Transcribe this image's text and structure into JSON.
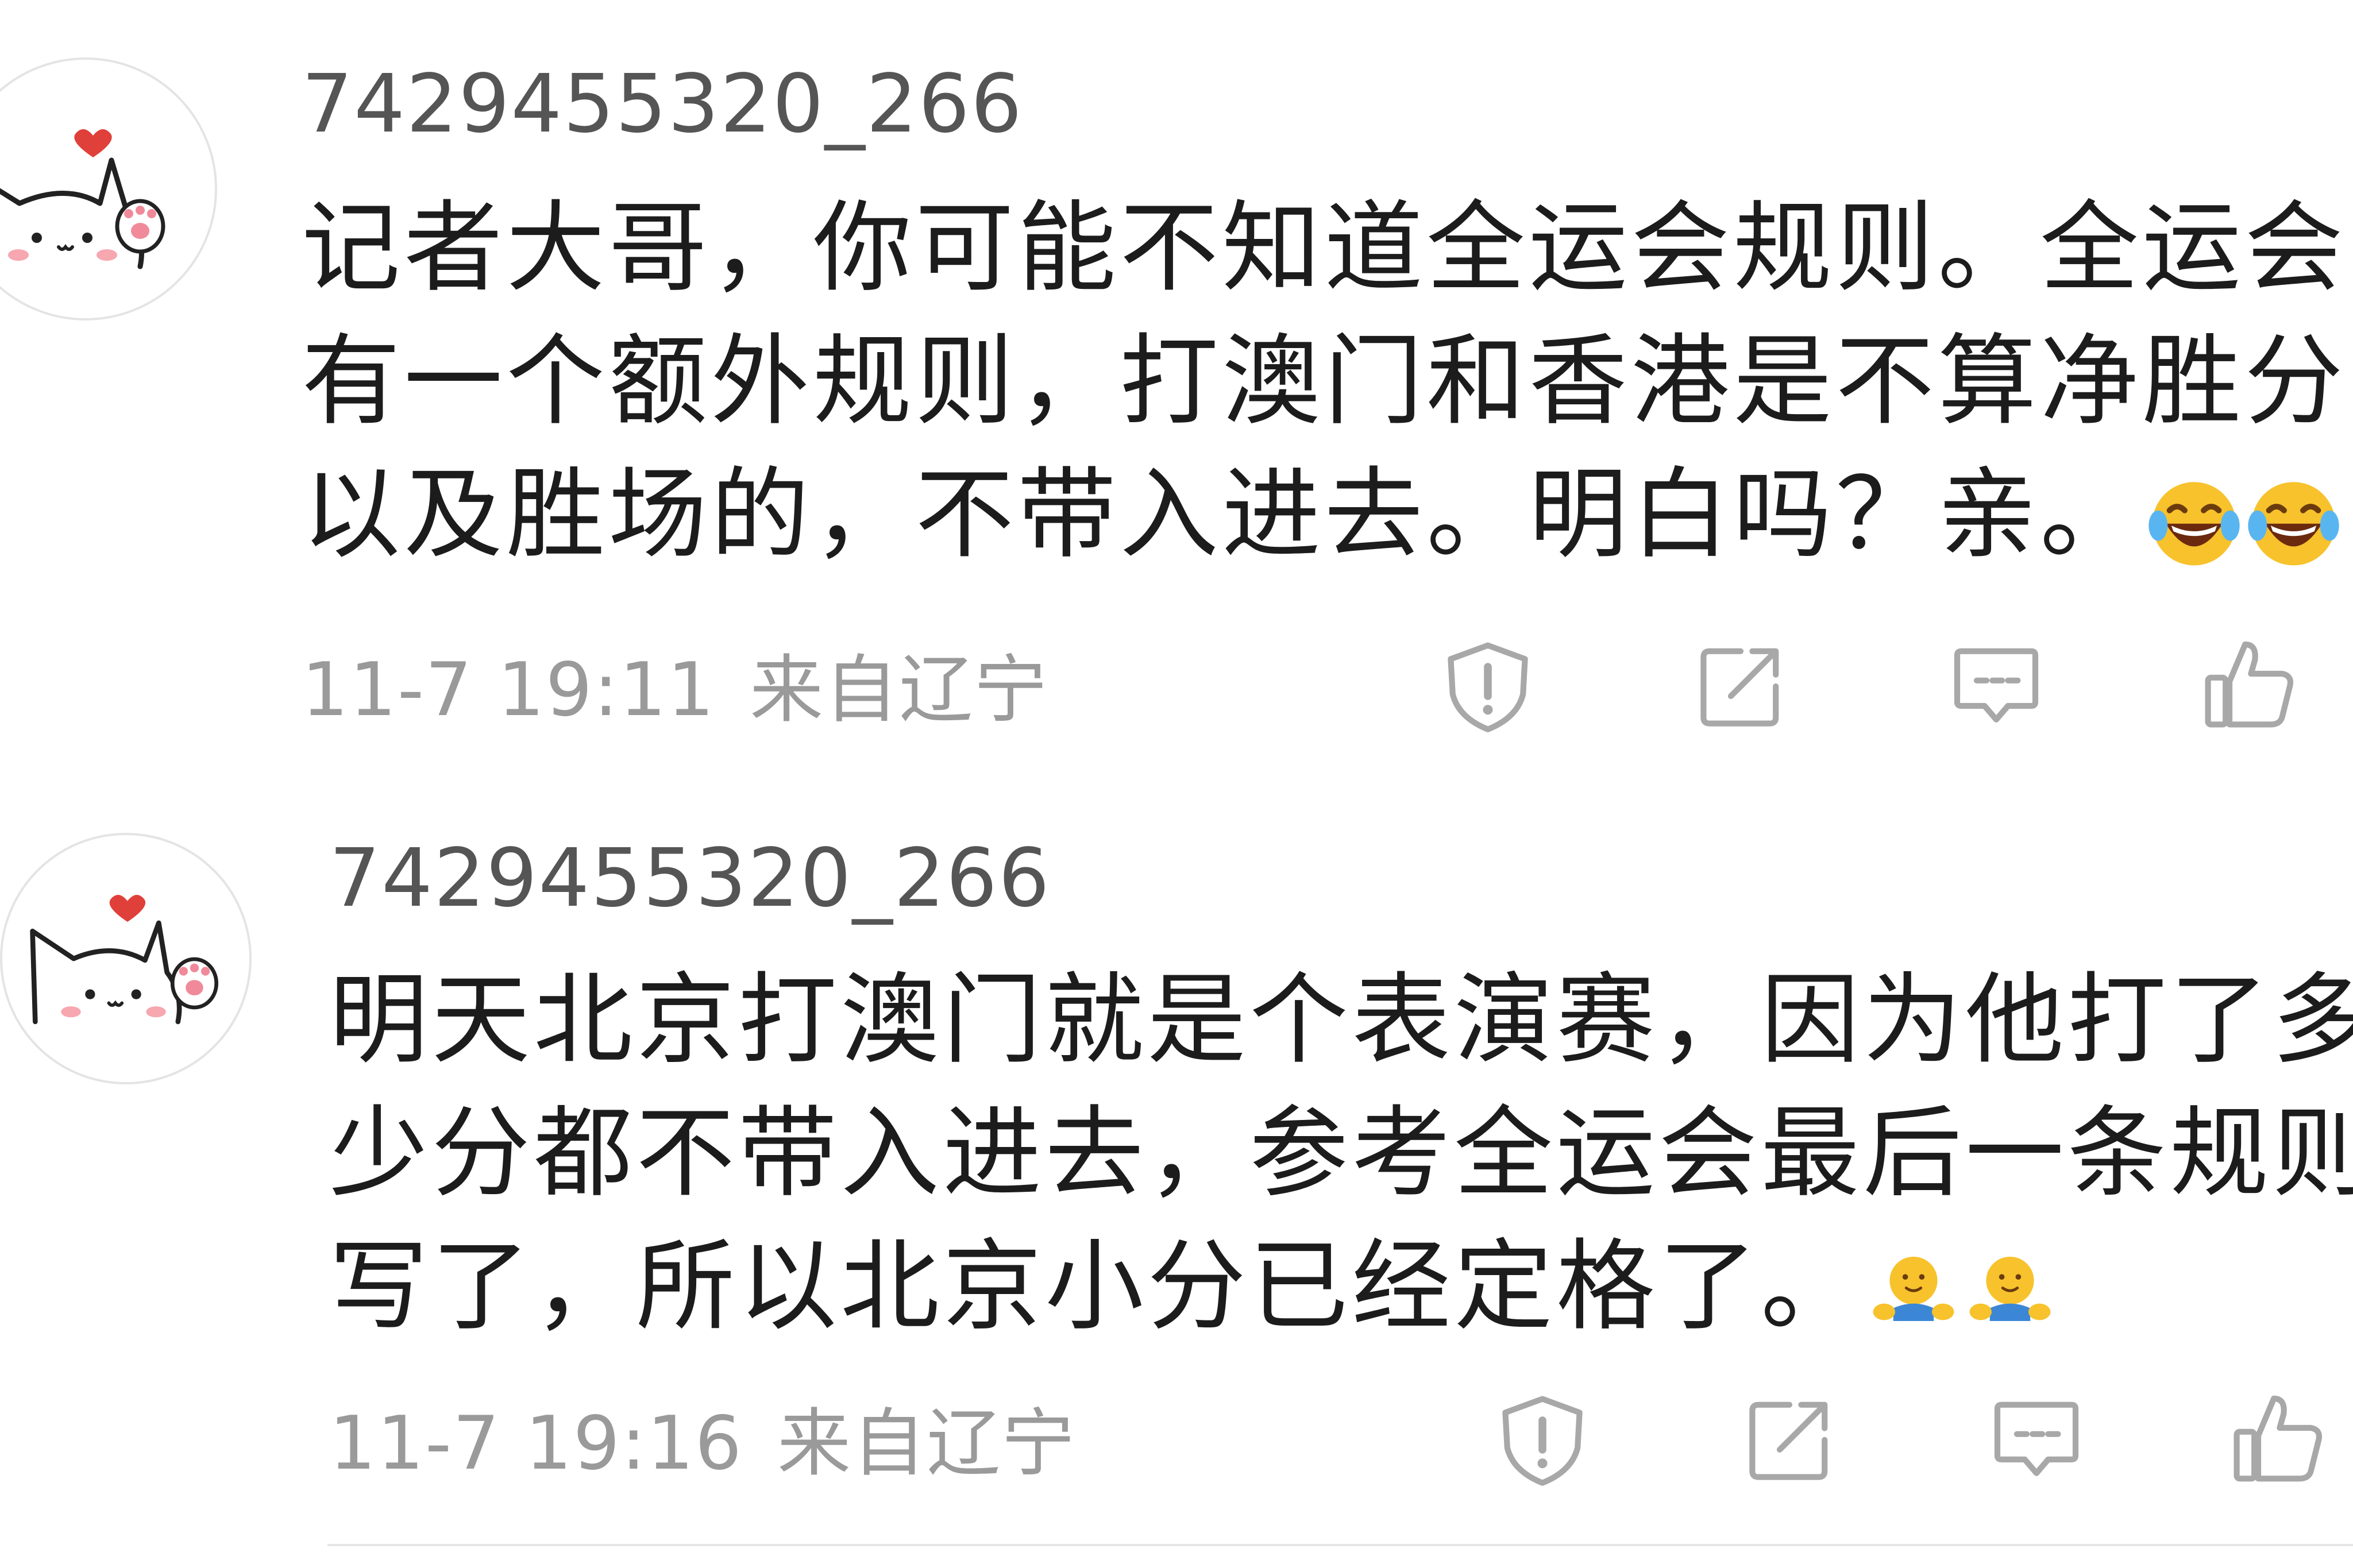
{
  "comments": [
    {
      "username": "7429455320_266",
      "lines": [
        "记者大哥，你可能不知道全运会规则。全运会",
        "有一个额外规则，打澳门和香港是不算净胜分",
        "以及胜场的，不带入进去。明白吗？亲。"
      ],
      "emojis": [
        "laughing-tears-emoji",
        "laughing-tears-emoji"
      ],
      "date": "11-7 19:11",
      "location": "来自辽宁",
      "actions": [
        "report-icon",
        "share-icon",
        "reply-icon",
        "like-icon"
      ]
    },
    {
      "username": "7429455320_266",
      "lines": [
        "明天北京打澳门就是个表演赛，因为他打了多",
        "少分都不带入进去，参考全运会最后一条规则",
        "写了，所以北京小分已经定格了。"
      ],
      "emojis": [
        "hug-emoji",
        "hug-emoji"
      ],
      "date": "11-7 19:16",
      "location": "来自辽宁",
      "actions": [
        "report-icon",
        "share-icon",
        "reply-icon",
        "like-icon"
      ]
    }
  ],
  "colors": {
    "username": "#555555",
    "body": "#1c1c1c",
    "meta": "#9a9a9a",
    "icon": "#a8a8a8",
    "heart": "#e0403a"
  }
}
